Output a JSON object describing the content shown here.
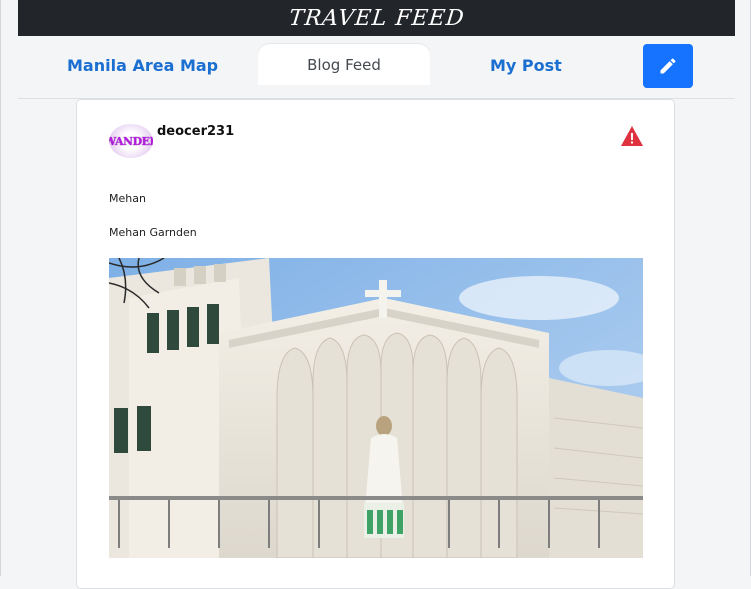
{
  "app": {
    "title": "TRAVEL FEED"
  },
  "nav": {
    "map_label": "Manila Area Map",
    "feed_label": "Blog Feed",
    "mypost_label": "My Post",
    "edit_icon": "pencil-icon"
  },
  "post": {
    "avatar_text": "WANDER",
    "username": "deocer231",
    "report_icon": "warning-icon",
    "title": "Mehan",
    "body": "Mehan Garnden",
    "image_icon": "church-photo"
  },
  "colors": {
    "titlebar": "#22252a",
    "link": "#1a6fd1",
    "button": "#1673ff",
    "warning": "#e03141"
  }
}
